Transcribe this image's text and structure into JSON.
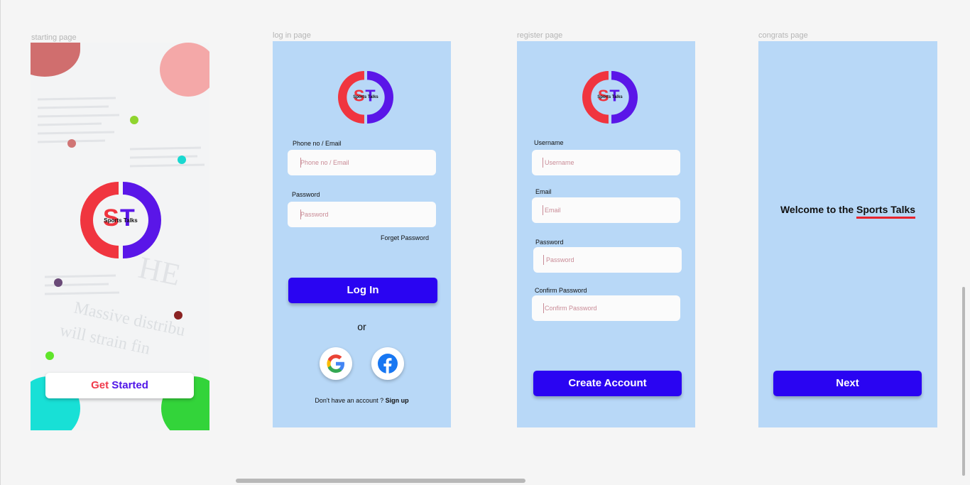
{
  "frames": {
    "starting": "starting page",
    "login": "log in page",
    "register": "register page",
    "congrats": "congrats page"
  },
  "logo": {
    "text": "Sports Talks",
    "letters": "ST"
  },
  "starting_page": {
    "get": "Get",
    "started": "Started"
  },
  "login_page": {
    "phone_label": "Phone no / Email",
    "phone_placeholder": "Phone no / Email",
    "password_label": "Password",
    "password_placeholder": "Password",
    "forget_password": "Forget Password",
    "login_button": "Log In",
    "or": "or",
    "no_account": "Don't have an account ?",
    "sign_up": "Sign up",
    "google_icon": "google-icon",
    "facebook_icon": "facebook-icon"
  },
  "register_page": {
    "username_label": "Username",
    "username_placeholder": "Username",
    "email_label": "Email",
    "email_placeholder": "Email",
    "password_label": "Password",
    "password_placeholder": "Password",
    "confirm_label": "Confirm Password",
    "confirm_placeholder": "Confirm Password",
    "create_button": "Create Account"
  },
  "congrats_page": {
    "welcome": "Welcome to the",
    "brand": "Sports Talks",
    "next_button": "Next"
  },
  "colors": {
    "frame_bg": "#b8d8f7",
    "primary_button": "#2a04f2",
    "logo_red": "#f0353f",
    "logo_purple": "#5a16e8",
    "underline": "#e8232d"
  }
}
